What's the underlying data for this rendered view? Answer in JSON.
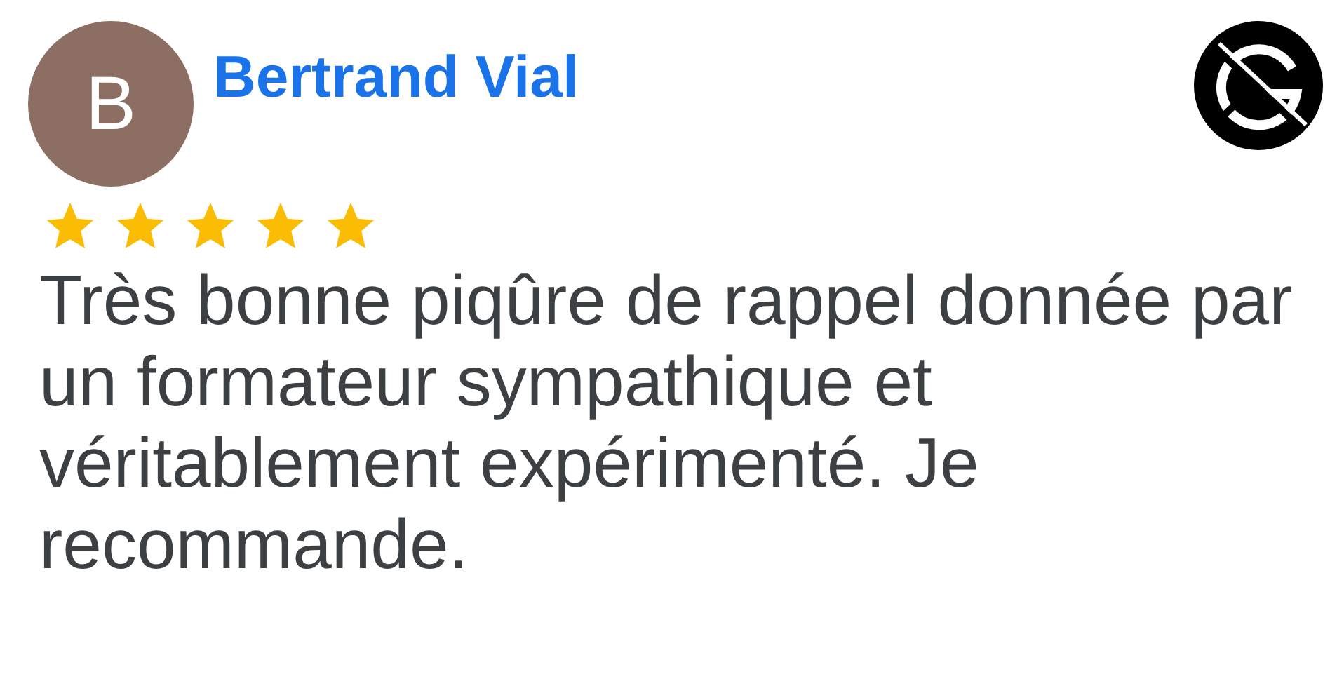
{
  "review": {
    "avatar_letter": "B",
    "author": "Bertrand Vial",
    "stars": 5,
    "text": "Très bonne piqûre de rappel donnée par un formateur sympathique et véritablement expérimenté. Je recommande."
  }
}
